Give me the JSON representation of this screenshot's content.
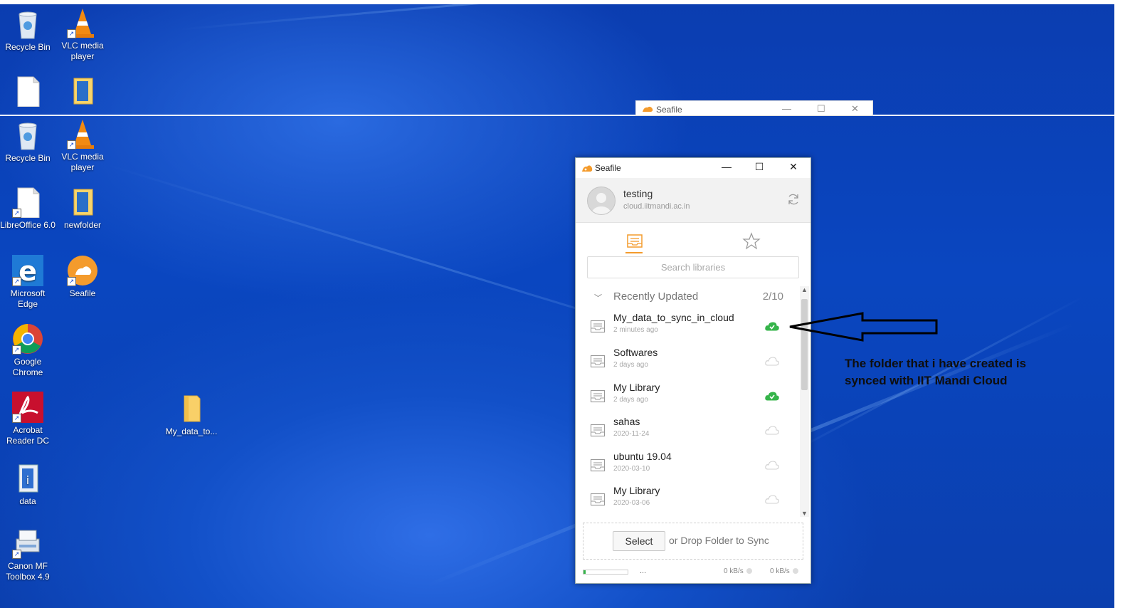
{
  "desktop": {
    "icons": [
      {
        "label": "Recycle Bin",
        "icon": "recycle-bin-icon"
      },
      {
        "label": "VLC media player",
        "icon": "vlc-icon"
      },
      {
        "label": "LibreOffice 6.0",
        "icon": "libreoffice-icon"
      },
      {
        "label": "newfolder",
        "icon": "folder-icon"
      },
      {
        "label": "Microsoft Edge",
        "icon": "edge-icon"
      },
      {
        "label": "Seafile",
        "icon": "seafile-icon"
      },
      {
        "label": "Google Chrome",
        "icon": "chrome-icon"
      },
      {
        "label": "Acrobat Reader DC",
        "icon": "acrobat-icon"
      },
      {
        "label": "data",
        "icon": "data-file-icon"
      },
      {
        "label": "Canon MF Toolbox 4.9",
        "icon": "printer-icon"
      },
      {
        "label": "My_data_to...",
        "icon": "folder-icon"
      }
    ]
  },
  "ghost_window": {
    "title": "Seafile"
  },
  "window": {
    "title": "Seafile",
    "account": {
      "name": "testing",
      "server": "cloud.iitmandi.ac.in"
    },
    "search_placeholder": "Search libraries",
    "section": {
      "label": "Recently Updated",
      "count": "2/10"
    },
    "libraries": [
      {
        "name": "My_data_to_sync_in_cloud",
        "time": "2 minutes ago",
        "synced": true
      },
      {
        "name": "Softwares",
        "time": "2 days ago",
        "synced": false
      },
      {
        "name": "My Library",
        "time": "2 days ago",
        "synced": true
      },
      {
        "name": "sahas",
        "time": "2020-11-24",
        "synced": false
      },
      {
        "name": "ubuntu 19.04",
        "time": "2020-03-10",
        "synced": false
      },
      {
        "name": "My Library",
        "time": "2020-03-06",
        "synced": false
      }
    ],
    "select_label": "Select",
    "drop_text": "or Drop Folder to Sync",
    "status": {
      "dots": "...",
      "upload_rate": "0 kB/s",
      "download_rate": "0 kB/s",
      "progress": 0.05
    }
  },
  "annotation": {
    "line1": "The folder that i have created is",
    "line2": "synced with IIT Mandi Cloud"
  },
  "colors": {
    "accent": "#f49b2c",
    "synced": "#35b44a",
    "desktop": "#0b46c0"
  }
}
